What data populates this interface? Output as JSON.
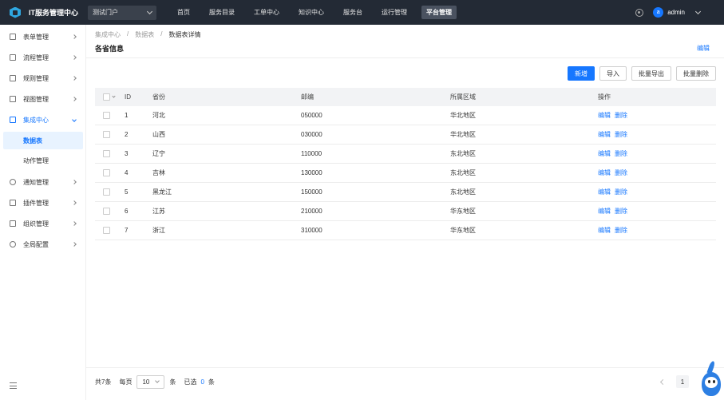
{
  "topbar": {
    "app_title": "IT服务管理中心",
    "portal_select": "测试门户",
    "nav": [
      {
        "label": "首页"
      },
      {
        "label": "服务目录"
      },
      {
        "label": "工单中心"
      },
      {
        "label": "知识中心"
      },
      {
        "label": "服务台"
      },
      {
        "label": "运行管理"
      },
      {
        "label": "平台管理",
        "active": true
      }
    ],
    "avatar_letter": "a",
    "username": "admin"
  },
  "sidebar": {
    "items": [
      {
        "label": "表单管理",
        "icon": "form-icon"
      },
      {
        "label": "流程管理",
        "icon": "flow-icon"
      },
      {
        "label": "规则管理",
        "icon": "rule-icon"
      },
      {
        "label": "视图管理",
        "icon": "view-icon"
      },
      {
        "label": "集成中心",
        "icon": "integration-icon",
        "open": true
      },
      {
        "label": "通知管理",
        "icon": "bell-icon"
      },
      {
        "label": "插件管理",
        "icon": "plugin-icon"
      },
      {
        "label": "组织管理",
        "icon": "org-icon"
      },
      {
        "label": "全局配置",
        "icon": "settings-icon"
      }
    ],
    "sub_items": [
      {
        "label": "数据表",
        "active": true
      },
      {
        "label": "动作管理"
      }
    ]
  },
  "breadcrumb": [
    {
      "label": "集成中心"
    },
    {
      "label": "数据表"
    },
    {
      "label": "数据表详情"
    }
  ],
  "page": {
    "title": "各省信息",
    "edit_label": "编辑"
  },
  "toolbar": {
    "add": "新增",
    "import": "导入",
    "batch_export": "批量导出",
    "batch_delete": "批量删除"
  },
  "table": {
    "headers": {
      "id": "ID",
      "province": "省份",
      "zip": "邮编",
      "region": "所属区域",
      "ops": "操作"
    },
    "ops": {
      "edit": "编辑",
      "delete": "删除"
    },
    "rows": [
      {
        "id": "1",
        "province": "河北",
        "zip": "050000",
        "region": "华北地区"
      },
      {
        "id": "2",
        "province": "山西",
        "zip": "030000",
        "region": "华北地区"
      },
      {
        "id": "3",
        "province": "辽宁",
        "zip": "110000",
        "region": "东北地区"
      },
      {
        "id": "4",
        "province": "吉林",
        "zip": "130000",
        "region": "东北地区"
      },
      {
        "id": "5",
        "province": "黑龙江",
        "zip": "150000",
        "region": "东北地区"
      },
      {
        "id": "6",
        "province": "江苏",
        "zip": "210000",
        "region": "华东地区"
      },
      {
        "id": "7",
        "province": "浙江",
        "zip": "310000",
        "region": "华东地区"
      }
    ]
  },
  "footer": {
    "total": "共7条",
    "per_page_label": "每页",
    "page_size": "10",
    "unit": "条",
    "selected_label": "已选",
    "selected_count": "0",
    "selected_unit": "条",
    "current_page": "1"
  },
  "colors": {
    "topbar_bg": "#232a35",
    "primary": "#1677ff",
    "active_menu_bg": "#e8f3ff",
    "table_header_bg": "#f2f3f5"
  }
}
